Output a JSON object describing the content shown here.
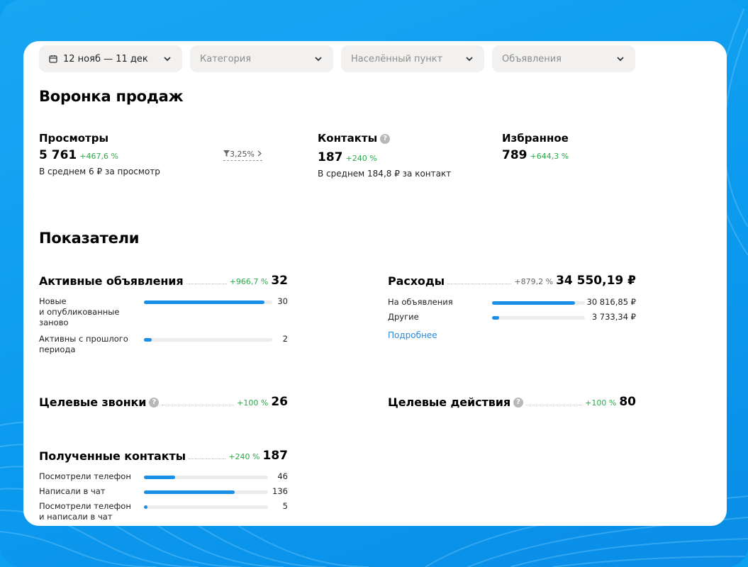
{
  "filters": {
    "date": "12 нояб — 11 дек",
    "category": "Категория",
    "city": "Населённый пункт",
    "ads": "Объявления"
  },
  "funnel": {
    "title": "Воронка продаж",
    "views": {
      "label": "Просмотры",
      "value": "5 761",
      "delta": "+467,6 %",
      "note": "В среднем 6 ₽ за просмотр",
      "conversion": "3,25%"
    },
    "contacts": {
      "label": "Контакты",
      "value": "187",
      "delta": "+240 %",
      "note": "В среднем 184,8 ₽ за контакт"
    },
    "favorites": {
      "label": "Избранное",
      "value": "789",
      "delta": "+644,3 %"
    }
  },
  "indicators": {
    "title": "Показатели",
    "active_ads": {
      "title": "Активные объявления",
      "delta": "+966,7 %",
      "value": "32",
      "rows": [
        {
          "label1": "Новые",
          "label2": "и опубликованные",
          "label3": "заново",
          "value": "30",
          "fraction": 0.94
        },
        {
          "label1": "Активны с прошлого",
          "label2": "периода",
          "value": "2",
          "fraction": 0.06
        }
      ]
    },
    "expenses": {
      "title": "Расходы",
      "delta": "+879,2 %",
      "value": "34 550,19 ₽",
      "rows": [
        {
          "label": "На объявления",
          "value": "30 816,85 ₽",
          "fraction": 0.89
        },
        {
          "label": "Другие",
          "value": "3 733,34 ₽",
          "fraction": 0.08
        }
      ],
      "more": "Подробнее"
    },
    "calls": {
      "title": "Целевые звонки",
      "delta": "+100 %",
      "value": "26"
    },
    "actions": {
      "title": "Целевые действия",
      "delta": "+100 %",
      "value": "80"
    },
    "received": {
      "title": "Полученные контакты",
      "delta": "+240 %",
      "value": "187",
      "rows": [
        {
          "label1": "Посмотрели телефон",
          "value": "46",
          "fraction": 0.25
        },
        {
          "label1": "Написали в чат",
          "value": "136",
          "fraction": 0.73
        },
        {
          "label1": "Посмотрели телефон",
          "label2": "и написали в чат",
          "value": "5",
          "fraction": 0.03
        }
      ]
    }
  },
  "colors": {
    "accent": "#1a8fe8",
    "positive": "#2ca84a",
    "background": "#0b9ff0"
  },
  "icons": {
    "calendar": "calendar-icon",
    "chevron": "chevron-down-icon",
    "filter": "funnel-icon",
    "help": "help-icon"
  }
}
